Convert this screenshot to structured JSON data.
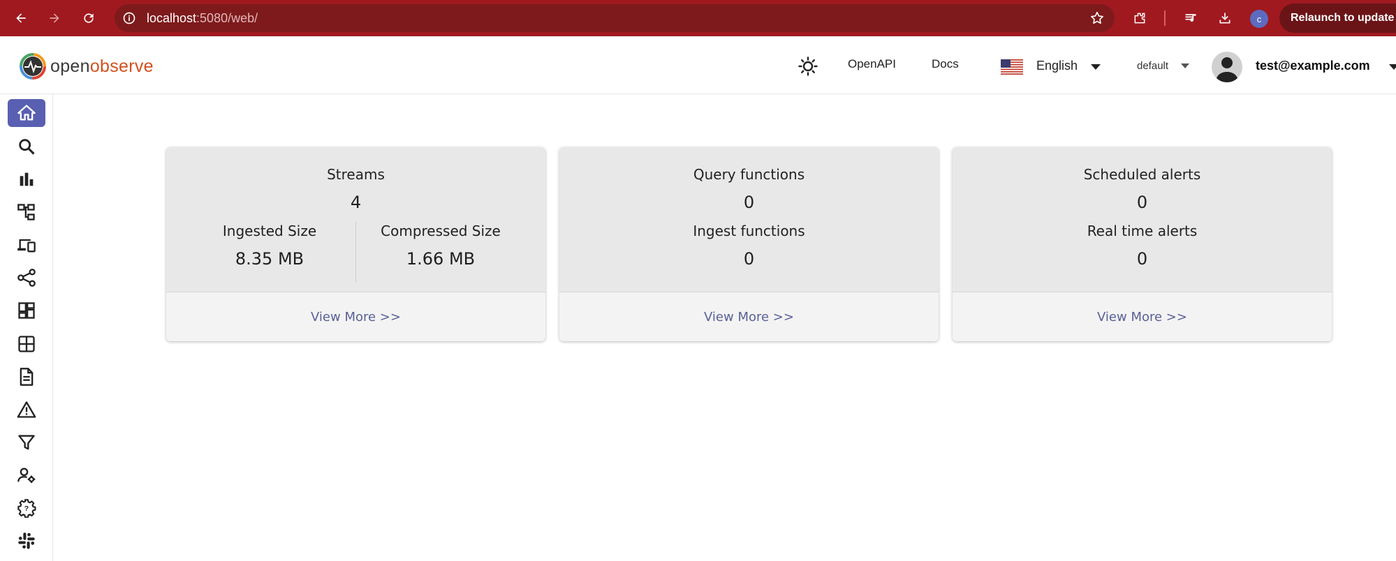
{
  "browser": {
    "url_host": "localhost",
    "url_rest": ":5080/web/",
    "profile_initial": "c",
    "relaunch_label": "Relaunch to update"
  },
  "header": {
    "logo_part1": "open",
    "logo_part2": "observe",
    "openapi_label": "OpenAPI",
    "docs_label": "Docs",
    "language": "English",
    "organization": "default",
    "user_email": "test@example.com"
  },
  "sidebar": {
    "items": [
      {
        "icon": "home-icon",
        "active": true
      },
      {
        "icon": "search-icon"
      },
      {
        "icon": "bar-chart-icon"
      },
      {
        "icon": "account-tree-icon"
      },
      {
        "icon": "devices-icon"
      },
      {
        "icon": "share-icon"
      },
      {
        "icon": "dashboard-icon"
      },
      {
        "icon": "table-icon"
      },
      {
        "icon": "document-icon"
      },
      {
        "icon": "warning-icon"
      },
      {
        "icon": "filter-icon"
      },
      {
        "icon": "user-settings-icon"
      },
      {
        "icon": "gear-icon"
      },
      {
        "icon": "slack-icon"
      }
    ]
  },
  "cards": {
    "streams": {
      "title": "Streams",
      "count": "4",
      "ingested_label": "Ingested Size",
      "ingested_value": "8.35 MB",
      "compressed_label": "Compressed Size",
      "compressed_value": "1.66 MB",
      "link": "View More >>"
    },
    "functions": {
      "query_label": "Query functions",
      "query_value": "0",
      "ingest_label": "Ingest functions",
      "ingest_value": "0",
      "link": "View More >>"
    },
    "alerts": {
      "scheduled_label": "Scheduled alerts",
      "scheduled_value": "0",
      "realtime_label": "Real time alerts",
      "realtime_value": "0",
      "link": "View More >>"
    }
  },
  "colors": {
    "chrome": "#a0191f",
    "accent": "#5960b2",
    "link": "#5a6196"
  }
}
